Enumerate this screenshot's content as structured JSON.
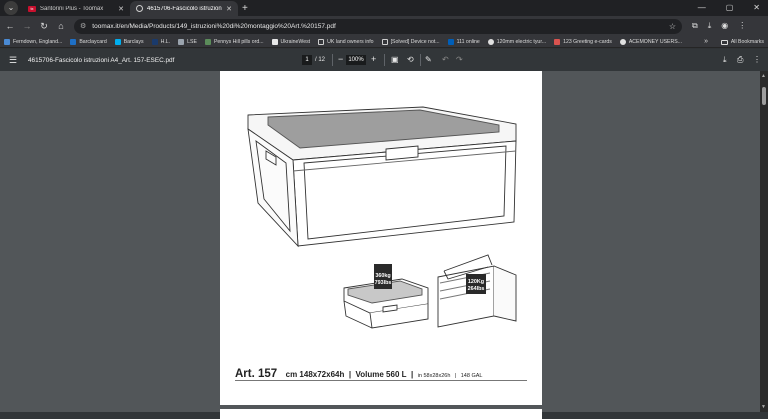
{
  "tabs": [
    {
      "title": "Santorini Plus - Toomax",
      "favicon": "toomax-favicon",
      "active": false
    },
    {
      "title": "4615706-Fascicolo istruzioni A4",
      "favicon": "globe-icon",
      "active": true
    }
  ],
  "address": {
    "url": "toomax.it/en/Media/Products/149_istruzioni%20di%20montaggio%20Art.%20157.pdf"
  },
  "bookmarks": [
    {
      "label": "Ferndown, England...",
      "color": "#4a8ad4"
    },
    {
      "label": "Barclaycard",
      "color": "#1e6fc5"
    },
    {
      "label": "Barclays",
      "color": "#00aeef"
    },
    {
      "label": "H.L.",
      "color": "#1a3a6b"
    },
    {
      "label": "LSE",
      "color": "#9aa3ad"
    },
    {
      "label": "Pennys Hill pills ord...",
      "color": "#5b8c5a"
    },
    {
      "label": "UkraineWest",
      "color": "#e8e8e8"
    },
    {
      "label": "UK land owners info",
      "color": "#cfcfcf"
    },
    {
      "label": "[Solved] Device not...",
      "color": "#cfcfcf"
    },
    {
      "label": "111 online",
      "color": "#005eb8"
    },
    {
      "label": "120mm electric tyur...",
      "color": "#e0e0e0"
    },
    {
      "label": "123 Greeting e-cards",
      "color": "#d9534f"
    },
    {
      "label": "ACEMONEY USERS...",
      "color": "#e0e0e0"
    }
  ],
  "bookmarks_more": "»",
  "all_bookmarks": "All Bookmarks",
  "pdf": {
    "doc_name": "4615706-Fascicolo istruzioni A4_Art. 157-ESEC.pdf",
    "page_current": "1",
    "page_total": "/ 12",
    "zoom": "100%"
  },
  "figure": {
    "weight_small_kg": "360kg",
    "weight_small_lbs": "793lbs",
    "weight_open_kg": "120Kg",
    "weight_open_lbs": "264lbs"
  },
  "caption": {
    "art": "Art. 157",
    "dims_cm": "cm 148x72x64h",
    "volume": "Volume 560 L",
    "dims_in": "in 58x28x26h",
    "gal": "148 GAL"
  }
}
